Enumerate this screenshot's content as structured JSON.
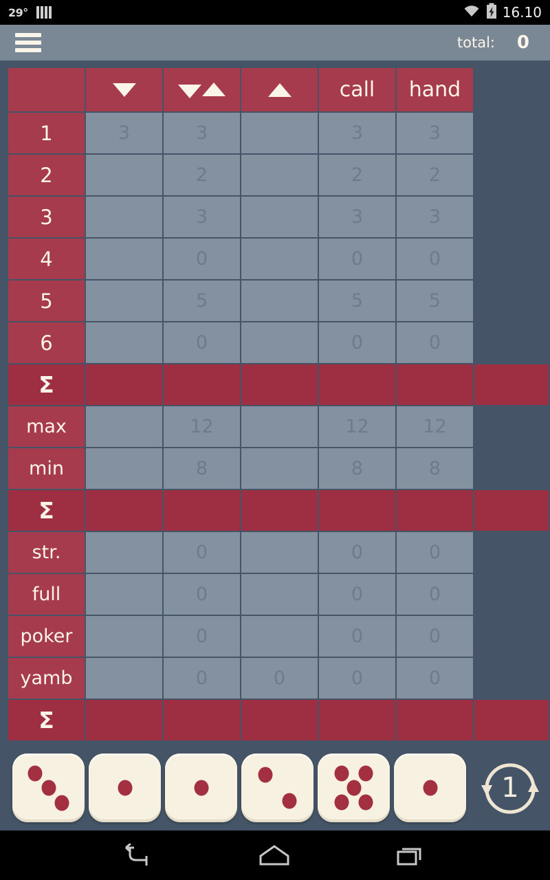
{
  "statusbar": {
    "temperature": "29°",
    "signal_icon": "signal-bars-icon",
    "wifi_icon": "wifi-icon",
    "battery_icon": "battery-charging-icon",
    "time": "16.10"
  },
  "appbar": {
    "menu_icon": "hamburger-menu-icon",
    "total_label": "total:",
    "total_value": "0"
  },
  "colors": {
    "background": "#455567",
    "accent_red": "#a63b4e",
    "sum_red": "#9e2f42",
    "cell_blue": "#8491a0",
    "appbar": "#7a8795",
    "cream": "#fbf4e8",
    "pip_red": "#a33040"
  },
  "scoresheet": {
    "columns": [
      {
        "id": "label",
        "label": "",
        "icon": ""
      },
      {
        "id": "down",
        "label": "",
        "icon": "triangle-down-icon"
      },
      {
        "id": "free",
        "label": "",
        "icon": "triangle-down-up-icon"
      },
      {
        "id": "up",
        "label": "",
        "icon": "triangle-up-icon"
      },
      {
        "id": "call",
        "label": "call",
        "icon": ""
      },
      {
        "id": "hand",
        "label": "hand",
        "icon": ""
      }
    ],
    "rows": [
      {
        "label": "1",
        "type": "data",
        "values": [
          "3",
          "3",
          "",
          "3",
          "3"
        ]
      },
      {
        "label": "2",
        "type": "data",
        "values": [
          "",
          "2",
          "",
          "2",
          "2"
        ]
      },
      {
        "label": "3",
        "type": "data",
        "values": [
          "",
          "3",
          "",
          "3",
          "3"
        ]
      },
      {
        "label": "4",
        "type": "data",
        "values": [
          "",
          "0",
          "",
          "0",
          "0"
        ]
      },
      {
        "label": "5",
        "type": "data",
        "values": [
          "",
          "5",
          "",
          "5",
          "5"
        ]
      },
      {
        "label": "6",
        "type": "data",
        "values": [
          "",
          "0",
          "",
          "0",
          "0"
        ]
      },
      {
        "label": "Σ",
        "type": "sum",
        "values": [
          "",
          "",
          "",
          "",
          "",
          ""
        ]
      },
      {
        "label": "max",
        "type": "data",
        "values": [
          "",
          "12",
          "",
          "12",
          "12"
        ]
      },
      {
        "label": "min",
        "type": "data",
        "values": [
          "",
          "8",
          "",
          "8",
          "8"
        ]
      },
      {
        "label": "Σ",
        "type": "sum",
        "values": [
          "",
          "",
          "",
          "",
          "",
          ""
        ]
      },
      {
        "label": "str.",
        "type": "data",
        "values": [
          "",
          "0",
          "",
          "0",
          "0"
        ]
      },
      {
        "label": "full",
        "type": "data",
        "values": [
          "",
          "0",
          "",
          "0",
          "0"
        ]
      },
      {
        "label": "poker",
        "type": "data",
        "values": [
          "",
          "0",
          "",
          "0",
          "0"
        ]
      },
      {
        "label": "yamb",
        "type": "data",
        "values": [
          "",
          "0",
          "0",
          "0",
          "0"
        ]
      },
      {
        "label": "Σ",
        "type": "sum",
        "values": [
          "",
          "",
          "",
          "",
          "",
          ""
        ]
      }
    ]
  },
  "dice": {
    "values": [
      3,
      1,
      1,
      2,
      5,
      1
    ],
    "reroll": {
      "icon": "reroll-circular-arrows-icon",
      "count": "1"
    }
  },
  "navbar": {
    "back": "back-icon",
    "home": "home-icon",
    "recents": "recents-icon"
  }
}
